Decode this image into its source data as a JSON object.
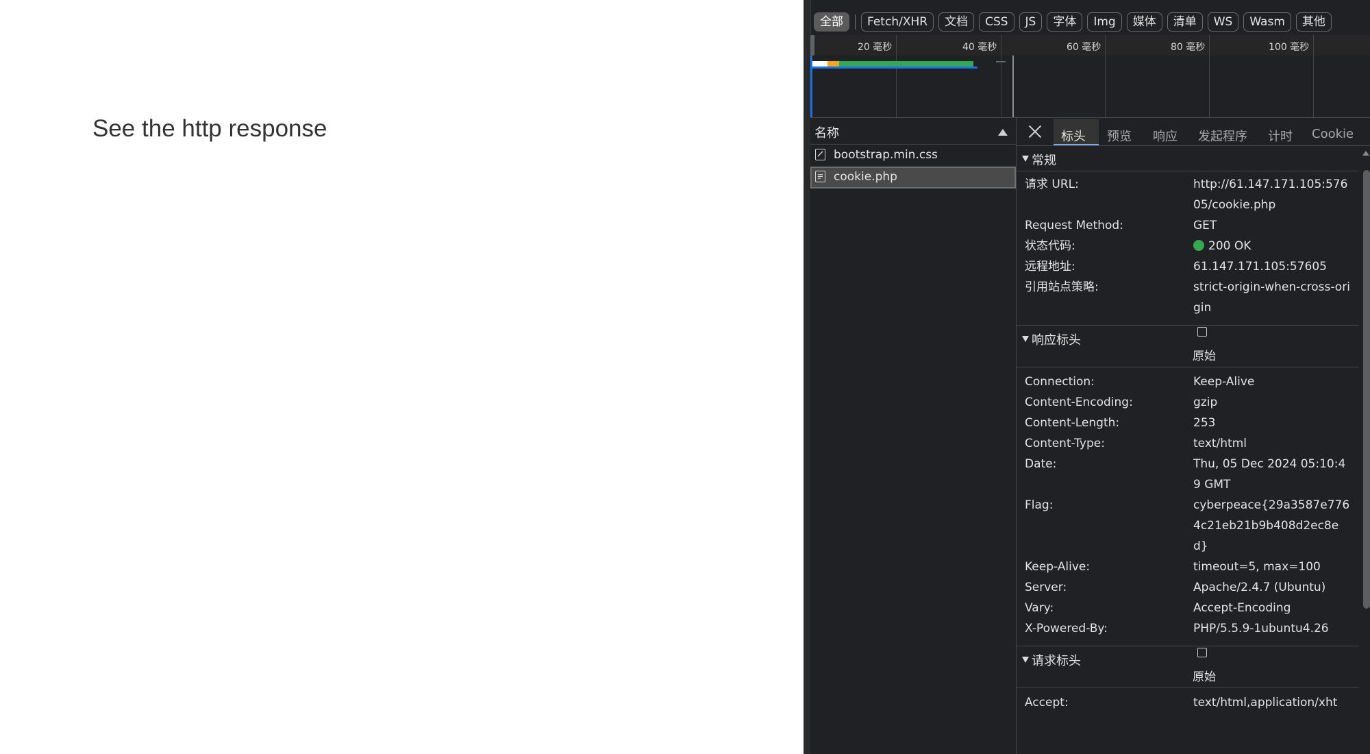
{
  "page": {
    "heading": "See the http response"
  },
  "filters": {
    "all": "全部",
    "items": [
      "Fetch/XHR",
      "文档",
      "CSS",
      "JS",
      "字体",
      "Img",
      "媒体",
      "清单",
      "WS",
      "Wasm",
      "其他"
    ]
  },
  "timeline": {
    "ticks": [
      "20 毫秒",
      "40 毫秒",
      "60 毫秒",
      "80 毫秒",
      "100 毫秒"
    ],
    "colors": {
      "queue": "#ffffff",
      "wait": "#f5a623",
      "download": "#34a853",
      "range": "#1a73e8"
    }
  },
  "request_list": {
    "header": "名称",
    "items": [
      {
        "name": "bootstrap.min.css"
      },
      {
        "name": "cookie.php"
      }
    ]
  },
  "details": {
    "tabs": [
      "标头",
      "预览",
      "响应",
      "发起程序",
      "计时",
      "Cookie"
    ],
    "general": {
      "title": "常规",
      "request_url_key": "请求 URL:",
      "request_url_value": "http://61.147.171.105:57605/cookie.php",
      "method_key": "Request Method:",
      "method_value": "GET",
      "status_key": "状态代码:",
      "status_value": "200 OK",
      "status_color": "#34a853",
      "remote_key": "远程地址:",
      "remote_value": "61.147.171.105:57605",
      "referrer_key": "引用站点策略:",
      "referrer_value": "strict-origin-when-cross-origin"
    },
    "response_headers": {
      "title": "响应标头",
      "raw_label": "原始",
      "rows": [
        {
          "k": "Connection:",
          "v": "Keep-Alive"
        },
        {
          "k": "Content-Encoding:",
          "v": "gzip"
        },
        {
          "k": "Content-Length:",
          "v": "253"
        },
        {
          "k": "Content-Type:",
          "v": "text/html"
        },
        {
          "k": "Date:",
          "v": "Thu, 05 Dec 2024 05:10:49 GMT"
        },
        {
          "k": "Flag:",
          "v": "cyberpeace{29a3587e7764c21eb21b9b408d2ec8ed}"
        },
        {
          "k": "Keep-Alive:",
          "v": "timeout=5, max=100"
        },
        {
          "k": "Server:",
          "v": "Apache/2.4.7 (Ubuntu)"
        },
        {
          "k": "Vary:",
          "v": "Accept-Encoding"
        },
        {
          "k": "X-Powered-By:",
          "v": "PHP/5.5.9-1ubuntu4.26"
        }
      ]
    },
    "request_headers": {
      "title": "请求标头",
      "raw_label": "原始",
      "rows": [
        {
          "k": "Accept:",
          "v": "text/html,application/xht"
        }
      ]
    }
  }
}
